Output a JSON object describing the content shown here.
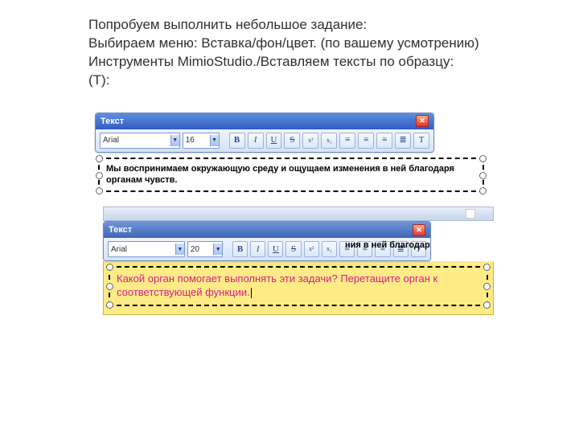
{
  "instruction": {
    "line1": "Попробуем выполнить небольшое задание:",
    "line2": "Выбираем меню: Вставка/фон/цвет. (по вашему усмотрению)",
    "line3": "Инструменты MimioStudio./Вставляем тексты по образцу:",
    "line4": "(Т):"
  },
  "shot1": {
    "title": "Текст",
    "font": "Arial",
    "size": "16",
    "buttons": {
      "bold": "B",
      "italic": "I",
      "underline": "U",
      "strike": "S",
      "sup": "x²",
      "sub": "x₂",
      "alignL": "≡",
      "alignC": "≡",
      "alignR": "≡",
      "list": "≣",
      "T": "T"
    },
    "text": "Мы воспринимаем окружающую среду и ощущаем изменения в ней благодаря органам чувств."
  },
  "shot2": {
    "title": "Текст",
    "font": "Arial",
    "size": "20",
    "partial": "ния в ней благодаря",
    "buttons": {
      "bold": "B",
      "italic": "I",
      "underline": "U",
      "strike": "S",
      "sup": "x²",
      "sub": "x₂",
      "alignL": "≡",
      "alignC": "≡",
      "alignR": "≡",
      "list": "≣",
      "T": "T"
    },
    "text": "Какой орган помогает выполнять эти задачи? Перетащите орган к соответствующей функции."
  }
}
